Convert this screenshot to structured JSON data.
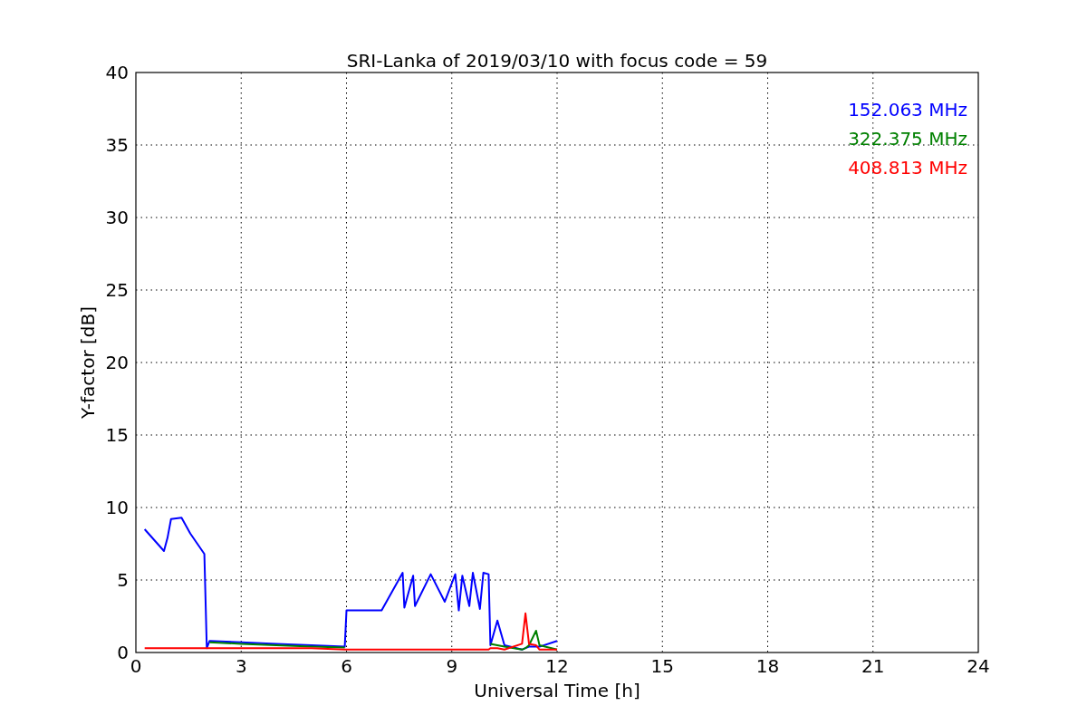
{
  "chart_data": {
    "type": "line",
    "title": "SRI-Lanka of 2019/03/10 with focus code = 59",
    "xlabel": "Universal Time [h]",
    "ylabel": "Y-factor [dB]",
    "x": [
      0.25,
      0.8,
      0.9,
      1.0,
      1.3,
      1.55,
      1.95,
      2.02,
      2.1,
      3,
      4,
      5,
      5.95,
      6.0,
      7,
      7.6,
      7.65,
      7.9,
      7.95,
      8.4,
      8.8,
      9.1,
      9.2,
      9.3,
      9.5,
      9.6,
      9.8,
      9.9,
      10.05,
      10.1,
      10.3,
      10.5,
      11.0,
      11.1,
      11.2,
      11.4,
      11.5,
      12
    ],
    "series": [
      {
        "name": "152.063 MHz",
        "color": "#0000ff",
        "values": [
          8.5,
          7.0,
          7.9,
          9.2,
          9.3,
          8.2,
          6.8,
          0.3,
          0.8,
          0.7,
          0.6,
          0.5,
          0.4,
          2.9,
          2.9,
          5.5,
          3.1,
          5.3,
          3.2,
          5.4,
          3.5,
          5.4,
          2.9,
          5.3,
          3.2,
          5.5,
          3.0,
          5.5,
          5.4,
          0.5,
          2.2,
          0.5,
          0.2,
          0.3,
          0.4,
          0.4,
          0.4,
          0.8
        ]
      },
      {
        "name": "322.375 MHz",
        "color": "#008000",
        "values": [
          null,
          null,
          null,
          null,
          null,
          null,
          null,
          null,
          0.7,
          0.6,
          0.5,
          0.4,
          0.35,
          null,
          null,
          null,
          null,
          null,
          null,
          null,
          null,
          null,
          null,
          null,
          null,
          null,
          null,
          null,
          null,
          0.6,
          0.5,
          0.4,
          0.2,
          0.3,
          0.5,
          1.5,
          0.5,
          0.2
        ]
      },
      {
        "name": "408.813 MHz",
        "color": "#ff0000",
        "values": [
          0.3,
          0.3,
          0.3,
          0.3,
          0.3,
          0.3,
          0.3,
          0.3,
          0.3,
          0.3,
          0.3,
          0.3,
          0.2,
          0.2,
          0.2,
          0.2,
          0.2,
          0.2,
          0.2,
          0.2,
          0.2,
          0.2,
          0.2,
          0.2,
          0.2,
          0.2,
          0.2,
          0.2,
          0.2,
          0.3,
          0.3,
          0.2,
          0.6,
          2.7,
          0.6,
          0.5,
          0.2,
          0.2
        ]
      }
    ],
    "grid": true,
    "xlim": [
      0,
      24
    ],
    "ylim": [
      0,
      40
    ],
    "xticks": [
      0,
      3,
      6,
      9,
      12,
      15,
      18,
      21,
      24
    ],
    "yticks": [
      0,
      5,
      10,
      15,
      20,
      25,
      30,
      35,
      40
    ]
  }
}
